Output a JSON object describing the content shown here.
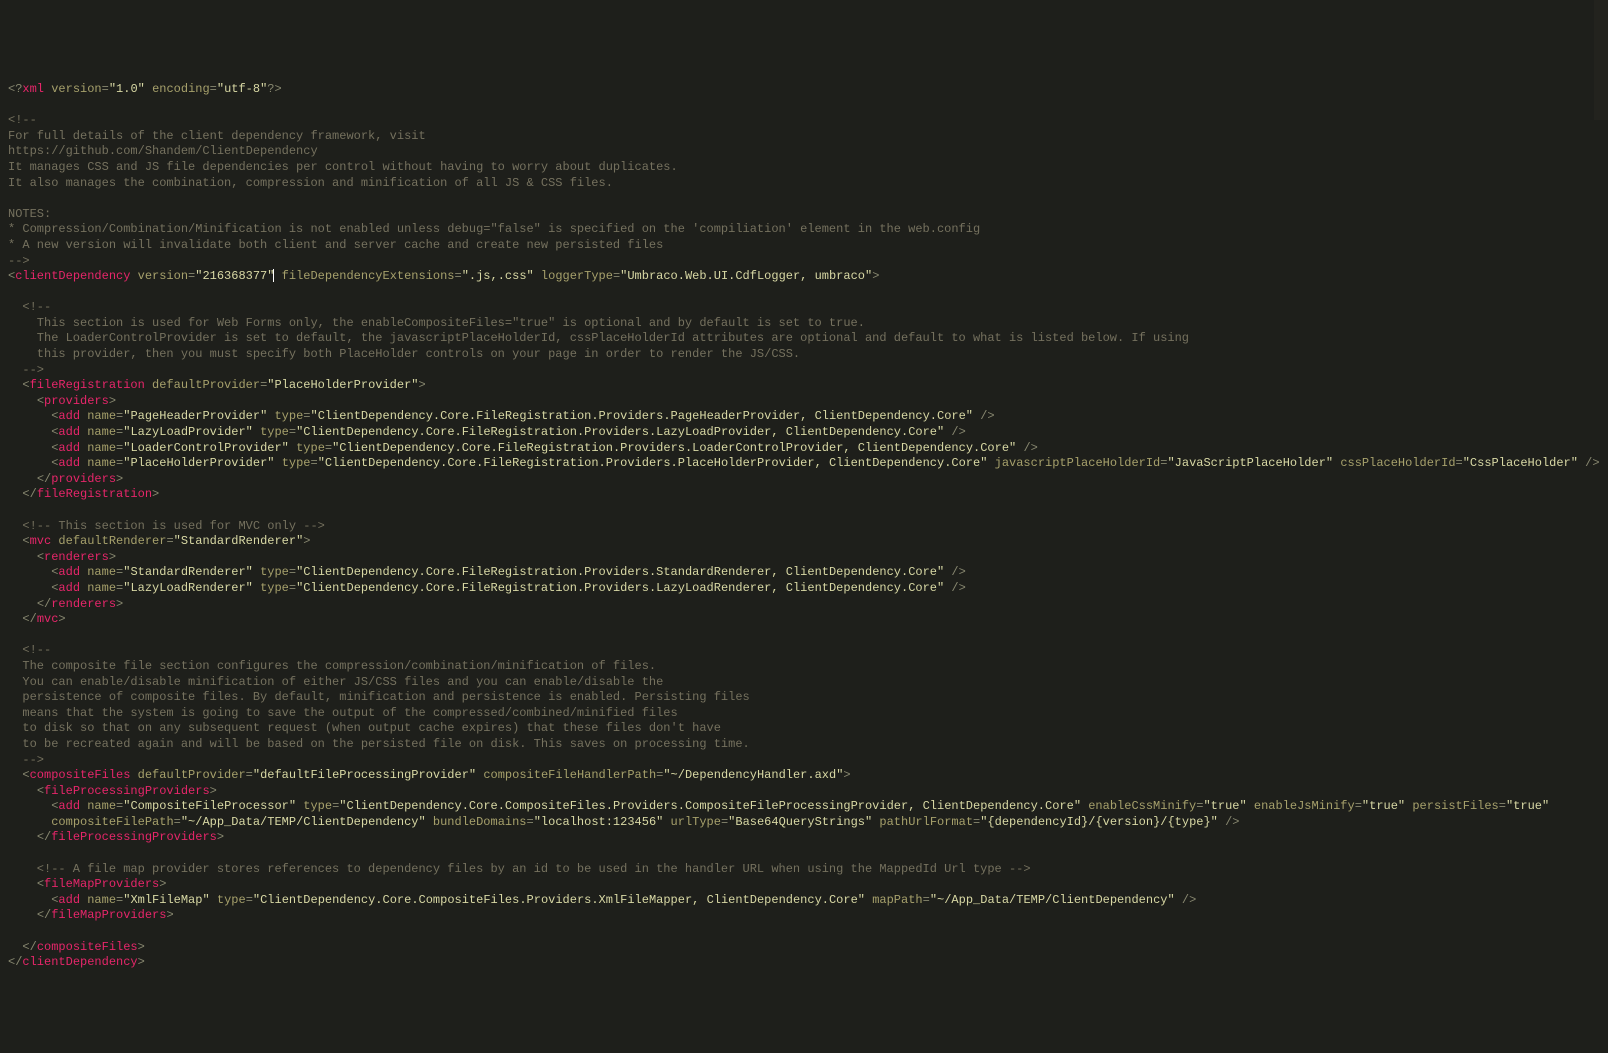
{
  "xml_declaration": {
    "pi_open": "<?",
    "pi_name": "xml",
    "version_attr": "version",
    "version_val": "\"1.0\"",
    "encoding_attr": "encoding",
    "encoding_val": "\"utf-8\"",
    "pi_close": "?>"
  },
  "comment1_lines": [
    "<!--",
    "For full details of the client dependency framework, visit",
    "https://github.com/Shandem/ClientDependency",
    "It manages CSS and JS file dependencies per control without having to worry about duplicates.",
    "It also manages the combination, compression and minification of all JS & CSS files.",
    "",
    "NOTES:",
    "* Compression/Combination/Minification is not enabled unless debug=\"false\" is specified on the 'compiliation' element in the web.config",
    "* A new version will invalidate both client and server cache and create new persisted files",
    "-->"
  ],
  "clientDependency": {
    "tag": "clientDependency",
    "attrs": [
      {
        "name": "version",
        "val": "\"216368377\""
      },
      {
        "name": "fileDependencyExtensions",
        "val": "\".js,.css\""
      },
      {
        "name": "loggerType",
        "val": "\"Umbraco.Web.UI.CdfLogger, umbraco\""
      }
    ]
  },
  "comment2_lines": [
    "  <!--",
    "    This section is used for Web Forms only, the enableCompositeFiles=\"true\" is optional and by default is set to true.",
    "    The LoaderControlProvider is set to default, the javascriptPlaceHolderId, cssPlaceHolderId attributes are optional and default to what is listed below. If using",
    "    this provider, then you must specify both PlaceHolder controls on your page in order to render the JS/CSS.",
    "  -->"
  ],
  "fileRegistration": {
    "tag": "fileRegistration",
    "attrs": [
      {
        "name": "defaultProvider",
        "val": "\"PlaceHolderProvider\""
      }
    ]
  },
  "providers_tag": "providers",
  "add_tag": "add",
  "fr_providers": [
    {
      "attrs": [
        {
          "name": "name",
          "val": "\"PageHeaderProvider\""
        },
        {
          "name": "type",
          "val": "\"ClientDependency.Core.FileRegistration.Providers.PageHeaderProvider, ClientDependency.Core\""
        }
      ]
    },
    {
      "attrs": [
        {
          "name": "name",
          "val": "\"LazyLoadProvider\""
        },
        {
          "name": "type",
          "val": "\"ClientDependency.Core.FileRegistration.Providers.LazyLoadProvider, ClientDependency.Core\""
        }
      ]
    },
    {
      "attrs": [
        {
          "name": "name",
          "val": "\"LoaderControlProvider\""
        },
        {
          "name": "type",
          "val": "\"ClientDependency.Core.FileRegistration.Providers.LoaderControlProvider, ClientDependency.Core\""
        }
      ]
    },
    {
      "attrs": [
        {
          "name": "name",
          "val": "\"PlaceHolderProvider\""
        },
        {
          "name": "type",
          "val": "\"ClientDependency.Core.FileRegistration.Providers.PlaceHolderProvider, ClientDependency.Core\""
        },
        {
          "name": "javascriptPlaceHolderId",
          "val": "\"JavaScriptPlaceHolder\""
        },
        {
          "name": "cssPlaceHolderId",
          "val": "\"CssPlaceHolder\""
        }
      ]
    }
  ],
  "comment3": "  <!-- This section is used for MVC only -->",
  "mvc": {
    "tag": "mvc",
    "attrs": [
      {
        "name": "defaultRenderer",
        "val": "\"StandardRenderer\""
      }
    ]
  },
  "renderers_tag": "renderers",
  "mvc_renderers": [
    {
      "attrs": [
        {
          "name": "name",
          "val": "\"StandardRenderer\""
        },
        {
          "name": "type",
          "val": "\"ClientDependency.Core.FileRegistration.Providers.StandardRenderer, ClientDependency.Core\""
        }
      ]
    },
    {
      "attrs": [
        {
          "name": "name",
          "val": "\"LazyLoadRenderer\""
        },
        {
          "name": "type",
          "val": "\"ClientDependency.Core.FileRegistration.Providers.LazyLoadRenderer, ClientDependency.Core\""
        }
      ]
    }
  ],
  "comment4_lines": [
    "  <!--",
    "  The composite file section configures the compression/combination/minification of files.",
    "  You can enable/disable minification of either JS/CSS files and you can enable/disable the",
    "  persistence of composite files. By default, minification and persistence is enabled. Persisting files",
    "  means that the system is going to save the output of the compressed/combined/minified files",
    "  to disk so that on any subsequent request (when output cache expires) that these files don't have",
    "  to be recreated again and will be based on the persisted file on disk. This saves on processing time.",
    "  -->"
  ],
  "compositeFiles": {
    "tag": "compositeFiles",
    "attrs": [
      {
        "name": "defaultProvider",
        "val": "\"defaultFileProcessingProvider\""
      },
      {
        "name": "compositeFileHandlerPath",
        "val": "\"~/DependencyHandler.axd\""
      }
    ]
  },
  "fileProcessingProviders_tag": "fileProcessingProviders",
  "cf_provider_line1_attrs": [
    {
      "name": "name",
      "val": "\"CompositeFileProcessor\""
    },
    {
      "name": "type",
      "val": "\"ClientDependency.Core.CompositeFiles.Providers.CompositeFileProcessingProvider, ClientDependency.Core\""
    },
    {
      "name": "enableCssMinify",
      "val": "\"true\""
    },
    {
      "name": "enableJsMinify",
      "val": "\"true\""
    },
    {
      "name": "persistFiles",
      "val": "\"true\""
    }
  ],
  "cf_provider_line2_attrs": [
    {
      "name": "compositeFilePath",
      "val": "\"~/App_Data/TEMP/ClientDependency\""
    },
    {
      "name": "bundleDomains",
      "val": "\"localhost:123456\""
    },
    {
      "name": "urlType",
      "val": "\"Base64QueryStrings\""
    },
    {
      "name": "pathUrlFormat",
      "val": "\"{dependencyId}/{version}/{type}\""
    }
  ],
  "comment5": "    <!-- A file map provider stores references to dependency files by an id to be used in the handler URL when using the MappedId Url type -->",
  "fileMapProviders_tag": "fileMapProviders",
  "fm_provider_attrs": [
    {
      "name": "name",
      "val": "\"XmlFileMap\""
    },
    {
      "name": "type",
      "val": "\"ClientDependency.Core.CompositeFiles.Providers.XmlFileMapper, ClientDependency.Core\""
    },
    {
      "name": "mapPath",
      "val": "\"~/App_Data/TEMP/ClientDependency\""
    }
  ]
}
